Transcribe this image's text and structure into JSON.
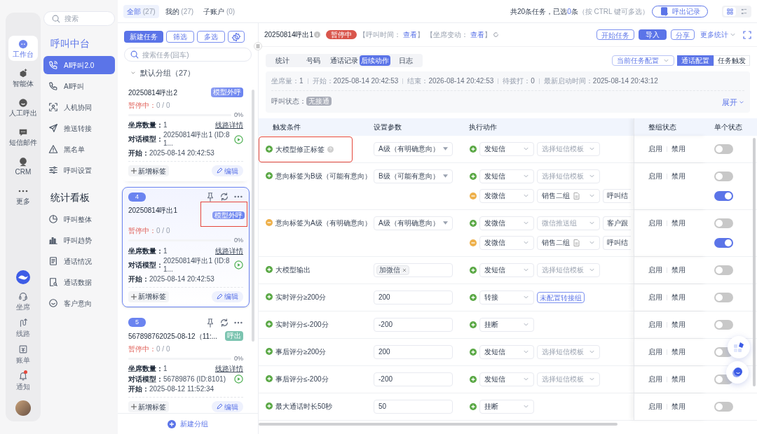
{
  "rail": {
    "items": [
      {
        "label": "工作台",
        "selected": true
      },
      {
        "label": "智能体",
        "selected": false
      },
      {
        "label": "人工呼出",
        "selected": false
      },
      {
        "label": "短信邮件",
        "selected": false
      },
      {
        "label": "CRM",
        "selected": false
      },
      {
        "label": "更多",
        "selected": false
      }
    ],
    "bottom_items": [
      {
        "label": "坐席",
        "unread": false
      },
      {
        "label": "线路",
        "unread": false
      },
      {
        "label": "账单",
        "unread": false
      },
      {
        "label": "通知",
        "unread": true
      }
    ]
  },
  "nav": {
    "search_placeholder": "搜索",
    "sections": [
      {
        "title": "呼叫中台",
        "active": true,
        "items": [
          {
            "label": "AI呼叫2.0",
            "selected": true
          },
          {
            "label": "AI呼叫",
            "selected": false
          },
          {
            "label": "人机协同",
            "selected": false
          },
          {
            "label": "推送转接",
            "selected": false
          },
          {
            "label": "黑名单",
            "selected": false
          },
          {
            "label": "呼叫设置",
            "selected": false
          }
        ]
      },
      {
        "title": "统计看板",
        "active": false,
        "items": [
          {
            "label": "呼叫整体",
            "selected": false
          },
          {
            "label": "呼叫趋势",
            "selected": false
          },
          {
            "label": "通话情况",
            "selected": false
          },
          {
            "label": "通话数据",
            "selected": false
          },
          {
            "label": "客户意向",
            "selected": false
          }
        ]
      }
    ]
  },
  "task_list": {
    "tabs": [
      {
        "label": "全部",
        "count": "(27)",
        "selected": true
      },
      {
        "label": "我的",
        "count": "(27)",
        "selected": false
      },
      {
        "label": "子账户",
        "count": "(0)",
        "selected": false
      }
    ],
    "buttons": [
      {
        "label": "新建任务",
        "kind": "primary"
      },
      {
        "label": "筛选",
        "kind": "outline"
      },
      {
        "label": "多选",
        "kind": "outline"
      }
    ],
    "search_placeholder": "搜索任务(回车)",
    "group": {
      "title": "默认分组（27）",
      "expanded": true
    },
    "cards": [
      {
        "title": "20250814呼出2",
        "tag": {
          "label": "模型外呼",
          "kind": "model"
        },
        "tag_highlighted": false,
        "selected": false,
        "status": "暂停中：",
        "count": "0 / 0",
        "level": 0,
        "percent": "0%",
        "fields": [
          {
            "label": "坐席数量：",
            "value": "1"
          },
          {
            "label": "对话模型：",
            "value": "20250814呼出1 (ID:81..."
          },
          {
            "label": "开始：",
            "value": "2025-08-14 20:42:53"
          }
        ],
        "link": "线路详情",
        "add_tag": "新增标签",
        "edit": "编辑"
      },
      {
        "index": "4",
        "title": "20250814呼出1",
        "tag": {
          "label": "模型外呼",
          "kind": "model"
        },
        "tag_highlighted": true,
        "selected": true,
        "status": "暂停中：",
        "count": "0 / 0",
        "level": 0,
        "percent": "0%",
        "fields": [
          {
            "label": "坐席数量：",
            "value": "1"
          },
          {
            "label": "对话模型：",
            "value": "20250814呼出1 (ID:81..."
          },
          {
            "label": "开始：",
            "value": "2025-08-14 20:42:53"
          }
        ],
        "link": "线路详情",
        "add_tag": "新增标签",
        "edit": "编辑"
      },
      {
        "index": "5",
        "title": "567898762025-08-12（11:...",
        "tag": {
          "label": "呼出",
          "kind": "outbound"
        },
        "tag_highlighted": false,
        "selected": false,
        "status": "暂停中：",
        "count": "0 / 0",
        "level": 0,
        "percent": "0%",
        "fields": [
          {
            "label": "坐席数量：",
            "value": "1"
          },
          {
            "label": "对话模型：",
            "value": "56789876 (ID:8101)"
          },
          {
            "label": "开始：",
            "value": "2025-08-12 11:52:34"
          }
        ],
        "link": "线路详情",
        "add_tag": "新增标签",
        "edit": "编辑"
      }
    ],
    "add_group": "新建分组"
  },
  "top_bar": {
    "summary_prefix": "共20条任务，已选",
    "summary_count": "0",
    "summary_suffix": "条",
    "hint": "（按 CTRL 键可多选）",
    "export_button": "呼出记录",
    "view_modes": [
      {
        "selected": true
      },
      {
        "selected": false
      }
    ]
  },
  "detail": {
    "title": "20250814呼出1",
    "status_badge": "暂停中",
    "meta": [
      {
        "label": "【呼叫时间：",
        "link": "查看",
        "suffix": "】"
      },
      {
        "label": "【坐席变动：",
        "link": "查看",
        "suffix": "】"
      }
    ],
    "actions": [
      {
        "label": "开始任务",
        "kind": "outline"
      },
      {
        "label": "导入",
        "kind": "primary"
      },
      {
        "label": "分享",
        "kind": "outline"
      },
      {
        "label": "更多统计",
        "kind": "dropdown"
      }
    ],
    "tabs": [
      {
        "label": "统计",
        "selected": false
      },
      {
        "label": "号码",
        "selected": false
      },
      {
        "label": "通话记录",
        "selected": false
      },
      {
        "label": "后续动作",
        "selected": true
      },
      {
        "label": "日志",
        "selected": false
      }
    ],
    "config_select": "当前任务配置",
    "config_modes": [
      {
        "label": "通话配置",
        "selected": true
      },
      {
        "label": "任务触发",
        "selected": false
      }
    ],
    "stats": [
      {
        "label": "坐席量：",
        "value": "1"
      },
      {
        "label": "开始：",
        "value": "2025-08-14 20:42:53"
      },
      {
        "label": "结束：",
        "value": "2026-08-14 20:42:53"
      },
      {
        "label": "待拨打：",
        "value": "0"
      },
      {
        "label": "最新启动时间：",
        "value": "2025-08-14 20:43:12"
      }
    ],
    "call_status_label": "呼叫状态：",
    "call_status": "无接通",
    "expand": "展开"
  },
  "table": {
    "columns": [
      "触发条件",
      "设置参数",
      "执行动作",
      "整组状态",
      "单个状态"
    ],
    "rows": [
      {
        "condition": "大模型修正标签",
        "active": true,
        "help": true,
        "highlighted": true,
        "param": {
          "kind": "select",
          "value": "A级（有明确意向）"
        },
        "group_status": [
          "启用",
          "禁用"
        ],
        "actions": [
          {
            "active": true,
            "action": "发短信",
            "target": {
              "kind": "placeholder",
              "text": "选择短信模板"
            },
            "on": false
          }
        ]
      },
      {
        "condition": "意向标签为B级（可能有意向）",
        "active": true,
        "help": false,
        "highlighted": false,
        "param": {
          "kind": "select",
          "value": "B级（可能有意向）"
        },
        "group_status": [
          "启用",
          "禁用"
        ],
        "actions": [
          {
            "active": true,
            "action": "发短信",
            "target": {
              "kind": "placeholder",
              "text": "选择短信模板"
            },
            "on": false
          },
          {
            "active": false,
            "action": "发微信",
            "target": {
              "kind": "document",
              "text": "销售二组"
            },
            "extra": "呼叫结",
            "on": true
          }
        ]
      },
      {
        "condition": "意向标签为A级（有明确意向）",
        "active": false,
        "help": false,
        "highlighted": false,
        "param": {
          "kind": "select",
          "value": "A级（有明确意向）"
        },
        "group_status": [
          "启用",
          "禁用"
        ],
        "actions": [
          {
            "active": true,
            "action": "发微信",
            "target": {
              "kind": "placeholder",
              "text": "微信推送组"
            },
            "extra": "客户跟",
            "on": false
          },
          {
            "active": false,
            "action": "发微信",
            "target": {
              "kind": "document",
              "text": "销售二组"
            },
            "extra": "呼叫结",
            "on": true
          }
        ]
      },
      {
        "condition": "大模型输出",
        "active": true,
        "help": false,
        "highlighted": false,
        "param": {
          "kind": "tags",
          "value": "加微信"
        },
        "group_status": [
          "启用",
          "禁用"
        ],
        "actions": [
          {
            "active": true,
            "action": "发短信",
            "target": {
              "kind": "placeholder",
              "text": "选择短信模板"
            },
            "on": false
          }
        ]
      },
      {
        "condition": "实时评分≥200分",
        "active": true,
        "help": false,
        "highlighted": false,
        "param": {
          "kind": "input",
          "value": "200"
        },
        "group_status": [
          "启用",
          "禁用"
        ],
        "actions": [
          {
            "active": true,
            "action": "转接",
            "target": {
              "kind": "button",
              "text": "未配置转接组"
            },
            "on": false
          }
        ]
      },
      {
        "condition": "实时评分≤-200分",
        "active": true,
        "help": false,
        "highlighted": false,
        "param": {
          "kind": "input",
          "value": "-200"
        },
        "group_status": [
          "启用",
          "禁用"
        ],
        "actions": [
          {
            "active": true,
            "action": "挂断",
            "on": false
          }
        ]
      },
      {
        "condition": "事后评分≥200分",
        "active": true,
        "help": false,
        "highlighted": false,
        "param": {
          "kind": "input",
          "value": "200"
        },
        "group_status": [
          "启用",
          "禁用"
        ],
        "actions": [
          {
            "active": true,
            "action": "发短信",
            "target": {
              "kind": "placeholder",
              "text": "选择短信模板"
            },
            "on": false
          }
        ]
      },
      {
        "condition": "事后评分≤-200分",
        "active": true,
        "help": false,
        "highlighted": false,
        "param": {
          "kind": "input",
          "value": "-200"
        },
        "group_status": [
          "启用",
          "禁用"
        ],
        "actions": [
          {
            "active": true,
            "action": "发短信",
            "target": {
              "kind": "placeholder",
              "text": "选择短信模板"
            },
            "on": false
          }
        ]
      },
      {
        "condition": "最大通话时长50秒",
        "active": true,
        "help": false,
        "highlighted": false,
        "param": {
          "kind": "input",
          "value": "50"
        },
        "group_status": [
          "启用",
          "禁用"
        ],
        "actions": [
          {
            "active": true,
            "action": "挂断",
            "on": false
          }
        ]
      }
    ]
  }
}
